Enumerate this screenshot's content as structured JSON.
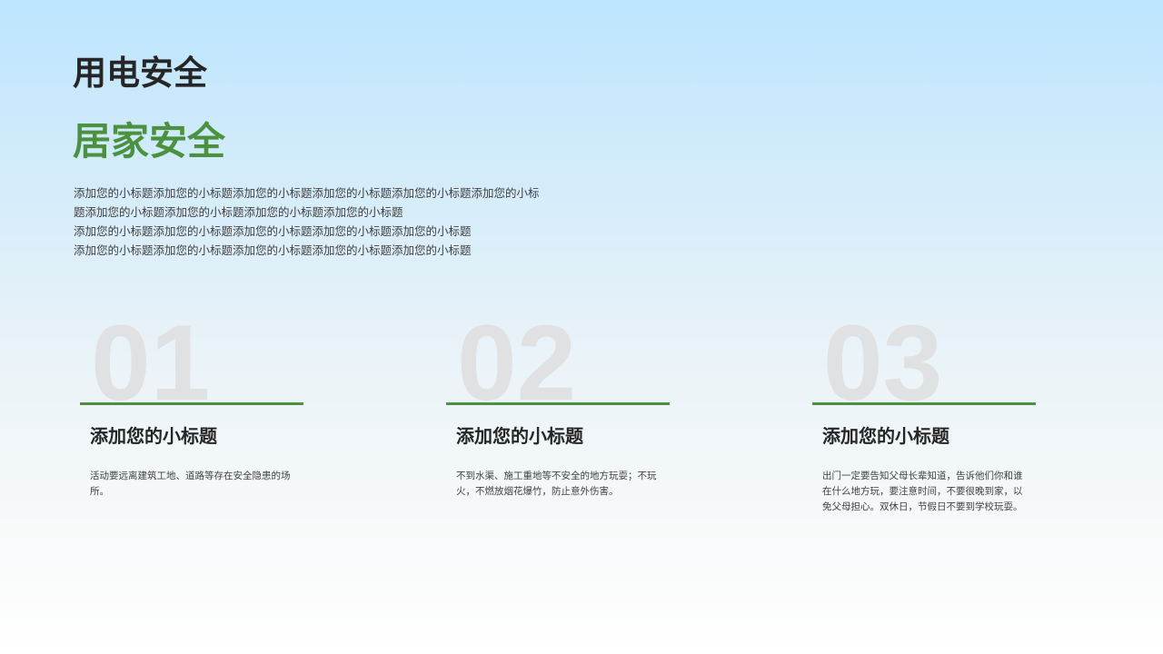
{
  "slide": {
    "title": "用电安全",
    "subtitle": "居家安全",
    "intro_lines": [
      "添加您的小标题添加您的小标题添加您的小标题添加您的小标题添加您的小标题添加您的小标",
      "题添加您的小标题添加您的小标题添加您的小标题添加您的小标题",
      "添加您的小标题添加您的小标题添加您的小标题添加您的小标题添加您的小标题",
      "添加您的小标题添加您的小标题添加您的小标题添加您的小标题添加您的小标题"
    ]
  },
  "cards": [
    {
      "number": "01",
      "heading": "添加您的小标题",
      "text": "活动要远离建筑工地、道路等存在安全隐患的场所。"
    },
    {
      "number": "02",
      "heading": "添加您的小标题",
      "text": "不到水渠、施工重地等不安全的地方玩耍；不玩火，不燃放烟花爆竹，防止意外伤害。"
    },
    {
      "number": "03",
      "heading": "添加您的小标题",
      "text": "出门一定要告知父母长辈知道，告诉他们你和谁在什么地方玩，要注意时间，不要很晚到家，以免父母担心。双休日，节假日不要到学校玩耍。"
    }
  ],
  "colors": {
    "accent_green": "#4b9140",
    "title_dark": "#262626",
    "number_gray": "#dfe1e2"
  }
}
